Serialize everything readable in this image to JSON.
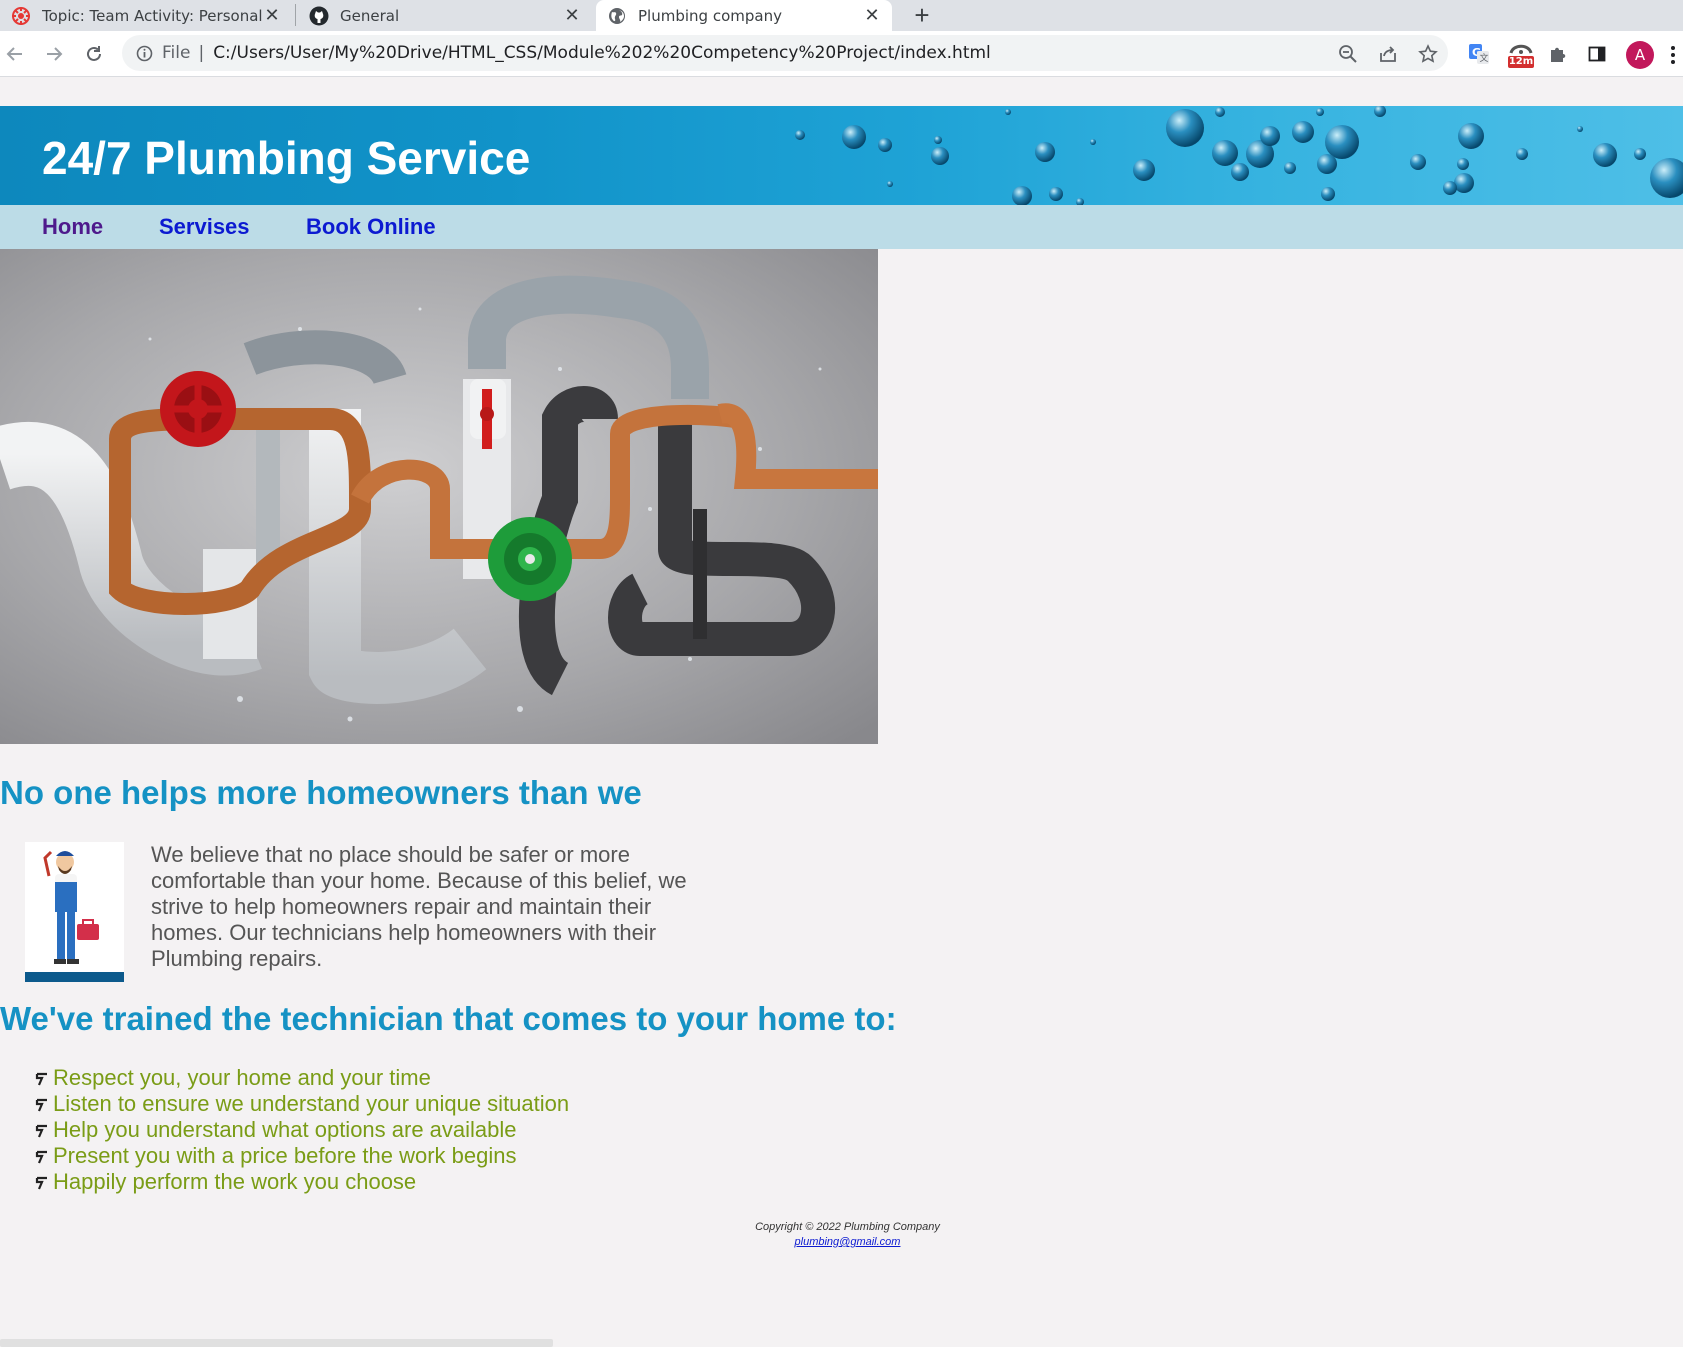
{
  "browser": {
    "tabs": [
      {
        "label": "Topic: Team Activity: Personal Pro",
        "icon": "byui-icon",
        "active": false
      },
      {
        "label": "General",
        "icon": "github-icon",
        "active": false
      },
      {
        "label": "Plumbing company",
        "icon": "globe-icon",
        "active": true
      }
    ],
    "address": {
      "scheme": "File",
      "url": "C:/Users/User/My%20Drive/HTML_CSS/Module%202%20Competency%20Project/index.html"
    },
    "extension_badge": "12m",
    "avatar_letter": "A"
  },
  "page": {
    "site_title": "24/7 Plumbing Service",
    "nav": [
      "Home",
      "Servises",
      "Book Online"
    ],
    "heading_1": "No one helps more homeowners than we",
    "intro": "We believe that no place should be safer or more comfortable than your home. Because of this belief, we strive to help homeowners repair and maintain their homes. Our technicians help homeowners with their Plumbing repairs.",
    "heading_2": "We've trained the technician that comes to your home to:",
    "promises": [
      "Respect you, your home and your time",
      "Listen to ensure we understand your unique situation",
      "Help you understand what options are available",
      "Present you with a price before the work begins",
      "Happily perform the work you choose"
    ],
    "footer": {
      "copyright": "Copyright © 2022 Plumbing Company",
      "email": "plumbing@gmail.com"
    }
  },
  "colors": {
    "banner": "#1193c9",
    "nav_bg": "#bcdce7",
    "link": "#0c1ad1",
    "heading": "#1592c4",
    "list_text": "#7a9c16",
    "page_bg": "#f4f2f3"
  }
}
